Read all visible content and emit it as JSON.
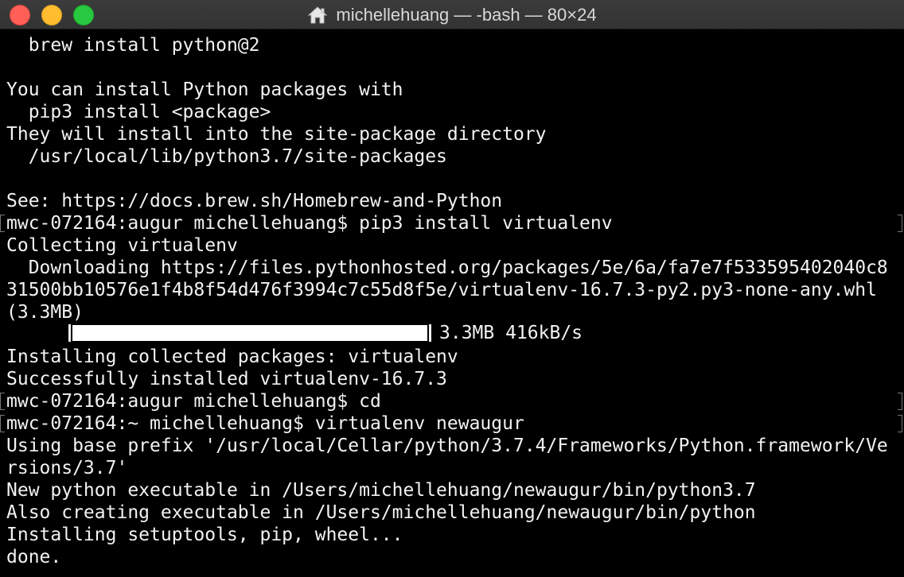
{
  "window": {
    "title": "michellehuang — -bash — 80×24",
    "home_icon": "home-icon",
    "buttons": {
      "close": "close",
      "minimize": "minimize",
      "zoom": "zoom"
    },
    "colors": {
      "close": "#ff5f57",
      "minimize": "#febc2e",
      "zoom": "#28c840",
      "background": "#000000",
      "text": "#f2f2f2"
    }
  },
  "terminal": {
    "lines": [
      "  brew install python@2",
      "",
      "You can install Python packages with",
      "  pip3 install <package>",
      "They will install into the site-package directory",
      "  /usr/local/lib/python3.7/site-packages",
      "",
      "See: https://docs.brew.sh/Homebrew-and-Python",
      "mwc-072164:augur michellehuang$ pip3 install virtualenv",
      "Collecting virtualenv",
      "  Downloading https://files.pythonhosted.org/packages/5e/6a/fa7e7f533595402040c8",
      "31500bb10576e1f4b8f54d476f3994c7c55d8f5e/virtualenv-16.7.3-py2.py3-none-any.whl",
      "(3.3MB)",
      "",
      "Installing collected packages: virtualenv",
      "Successfully installed virtualenv-16.7.3",
      "mwc-072164:augur michellehuang$ cd",
      "mwc-072164:~ michellehuang$ virtualenv newaugur",
      "Using base prefix '/usr/local/Cellar/python/3.7.4/Frameworks/Python.framework/Ve",
      "rsions/3.7'",
      "New python executable in /Users/michellehuang/newaugur/bin/python3.7",
      "Also creating executable in /Users/michellehuang/newaugur/bin/python",
      "Installing setuptools, pip, wheel...",
      "done."
    ],
    "progress": {
      "fraction": 1.0,
      "size": "3.3MB",
      "speed": "416kB/s",
      "text": "3.3MB 416kB/s"
    }
  }
}
